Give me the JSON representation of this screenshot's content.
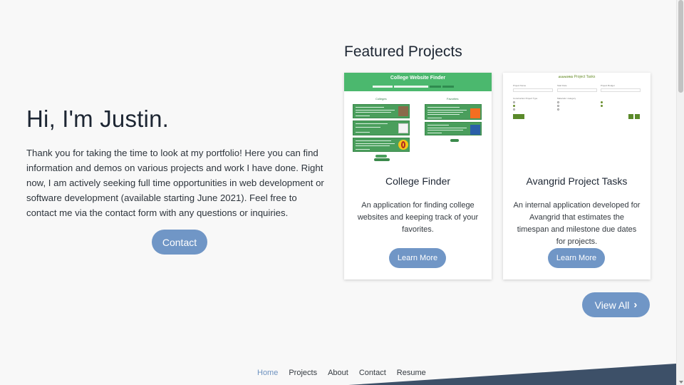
{
  "hero": {
    "title": "Hi, I'm Justin.",
    "text": "Thank you for taking the time to look at my portfolio! Here you can find information and demos on various projects and work I have done. Right now, I am actively seeking full time opportunities in web development or software development (available starting June 2021). Feel free to contact me via the contact form with any questions or inquiries.",
    "contact_label": "Contact"
  },
  "featured": {
    "title": "Featured Projects",
    "view_all_label": "View All",
    "projects": [
      {
        "title": "College Finder",
        "description": "An application for finding college websites and keeping track of your favorites.",
        "button_label": "Learn More",
        "thumbnail": {
          "header": "College Website Finder",
          "left_column": "Colleges",
          "right_column": "Favorites"
        }
      },
      {
        "title": "Avangrid Project Tasks",
        "description": "An internal application developed for Avangrid that estimates the timespan and milestone due dates for projects.",
        "button_label": "Learn More",
        "thumbnail": {
          "header": "Project Tasks",
          "brand": "AVANGRID"
        }
      }
    ]
  },
  "footer": {
    "nav": [
      "Home",
      "Projects",
      "About",
      "Contact",
      "Resume"
    ],
    "active": "Home"
  },
  "colors": {
    "accent": "#7096c6",
    "footer_shape": "#3d5068",
    "college_green": "#4bb86e"
  }
}
